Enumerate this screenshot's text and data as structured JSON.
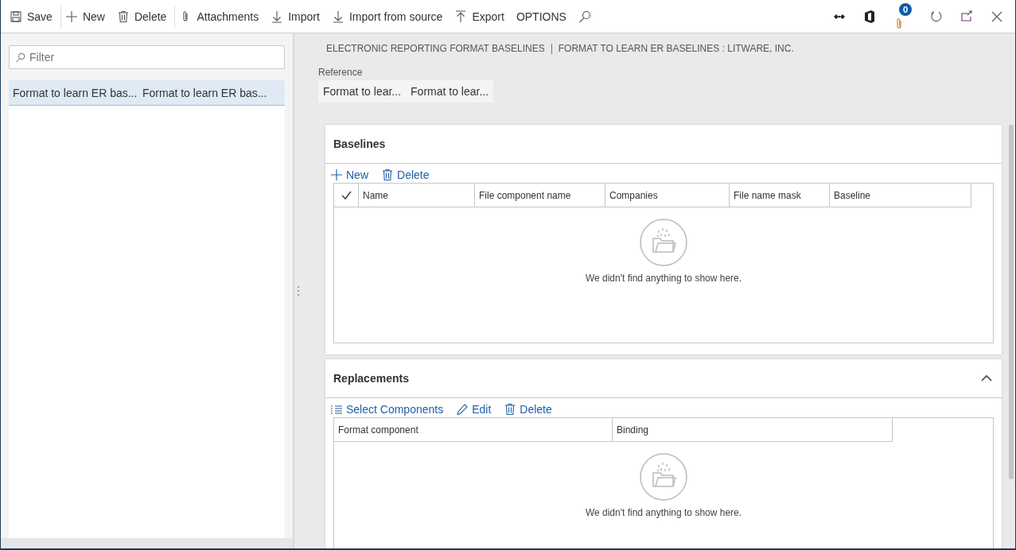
{
  "toolbar": {
    "items": [
      {
        "label": "Save",
        "kind": "save",
        "separator_after": true
      },
      {
        "label": "New",
        "kind": "plus",
        "separator_after": false
      },
      {
        "label": "Delete",
        "kind": "trash",
        "separator_after": true
      },
      {
        "label": "Attachments",
        "kind": "clip",
        "separator_after": false
      },
      {
        "label": "Import",
        "kind": "down",
        "separator_after": false
      },
      {
        "label": "Import from source",
        "kind": "down",
        "separator_after": false
      },
      {
        "label": "Export",
        "kind": "up",
        "separator_after": false
      },
      {
        "label": "OPTIONS",
        "kind": "text",
        "separator_after": false
      }
    ],
    "notification_badge": "0"
  },
  "list_pane": {
    "filter": {
      "placeholder": "Filter"
    },
    "rows": [
      {
        "cells": [
          "Format to learn ER bas...",
          "Format to learn ER bas..."
        ],
        "selected": true
      }
    ]
  },
  "breadcrumb": [
    "ELECTRONIC REPORTING FORMAT BASELINES",
    "FORMAT TO LEARN ER BASELINES : LITWARE, INC."
  ],
  "reference": {
    "label": "Reference",
    "values": [
      "Format to lear...",
      "Format to lear..."
    ]
  },
  "sections": [
    {
      "title": "Baselines",
      "actions": [
        {
          "label": "New",
          "kind": "plus"
        },
        {
          "label": "Delete",
          "kind": "trash"
        }
      ],
      "select_column": true,
      "columns": [
        "Name",
        "File component name",
        "Companies",
        "File name mask",
        "Baseline"
      ],
      "empty_message": "We didn't find anything to show here."
    },
    {
      "title": "Replacements",
      "expanded": true,
      "actions": [
        {
          "label": "Select Components",
          "kind": "list"
        },
        {
          "label": "Edit",
          "kind": "pencil"
        },
        {
          "label": "Delete",
          "kind": "trash"
        }
      ],
      "select_column": false,
      "columns": [
        "Format component",
        "Binding"
      ],
      "empty_message": "We didn't find anything to show here."
    }
  ]
}
